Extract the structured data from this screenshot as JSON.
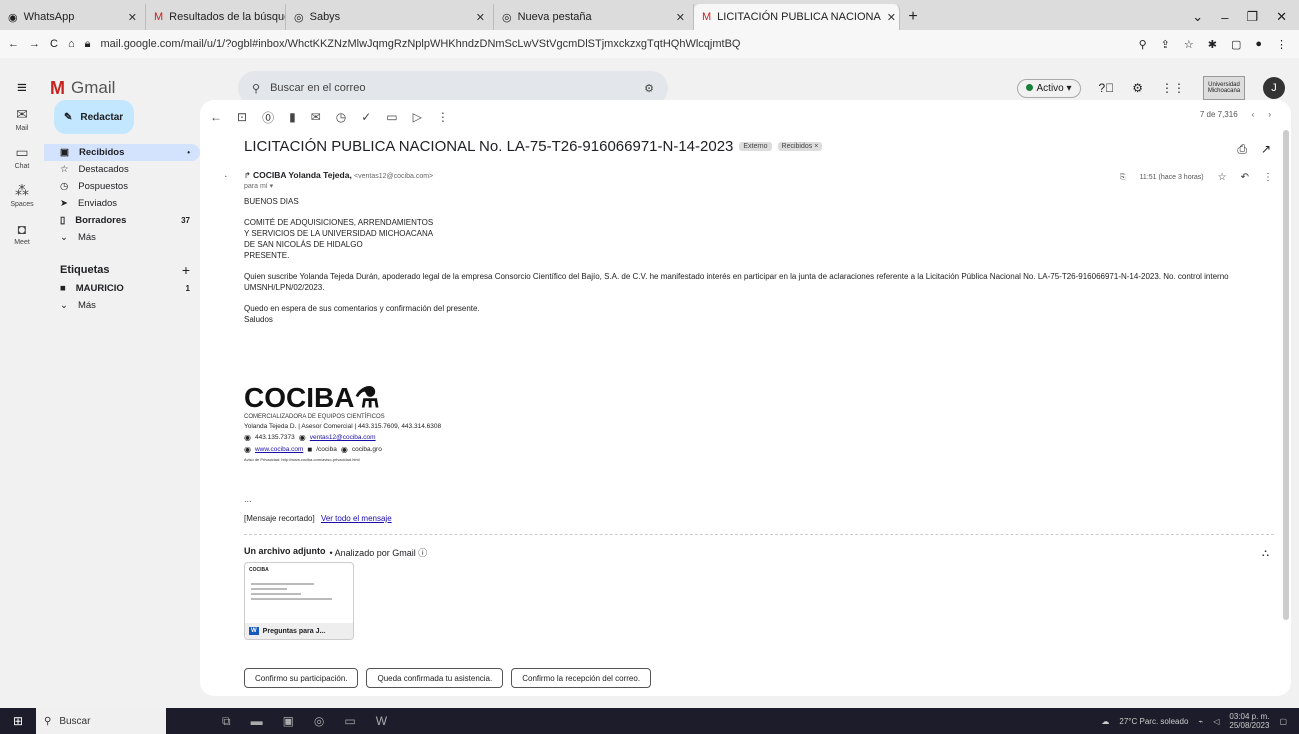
{
  "browser": {
    "tabs": [
      {
        "label": "WhatsApp",
        "icon": "whatsapp-icon"
      },
      {
        "label": "Resultados de la búsqueda - ja",
        "icon": "gmail-icon"
      },
      {
        "label": "Sabys",
        "icon": "chrome-icon"
      },
      {
        "label": "Nueva pestaña",
        "icon": "chrome-icon"
      },
      {
        "label": "LICITACIÓN PUBLICA NACIONA",
        "icon": "gmail-icon"
      }
    ],
    "url": "mail.google.com/mail/u/1/?ogbl#inbox/WhctKKZNzMlwJqmgRzNplpWHKhndzDNmScLwVStVgcmDlSTjmxckzxgTqtHQhWlcqjmtBQ"
  },
  "gmail": {
    "logo_text": "Gmail",
    "search_placeholder": "Buscar en el correo",
    "status": "Activo",
    "org_logo_text": "Universidad Michoacana",
    "avatar_initial": "J",
    "rail": [
      {
        "label": "Mail",
        "icon": "mail-icon"
      },
      {
        "label": "Chat",
        "icon": "chat-icon"
      },
      {
        "label": "Spaces",
        "icon": "spaces-icon"
      },
      {
        "label": "Meet",
        "icon": "meet-icon"
      }
    ],
    "compose_label": "Redactar",
    "nav": [
      {
        "label": "Recibidos",
        "count": "•",
        "icon": "inbox-icon"
      },
      {
        "label": "Destacados",
        "count": "",
        "icon": "star-icon"
      },
      {
        "label": "Pospuestos",
        "count": "",
        "icon": "clock-icon"
      },
      {
        "label": "Enviados",
        "count": "",
        "icon": "send-icon"
      },
      {
        "label": "Borradores",
        "count": "37",
        "icon": "draft-icon"
      },
      {
        "label": "Más",
        "count": "",
        "icon": "chevron-down-icon"
      }
    ],
    "labels_title": "Etiquetas",
    "labels": [
      {
        "label": "MAURICIO",
        "count": "1"
      },
      {
        "label": "Más",
        "count": ""
      }
    ]
  },
  "email": {
    "pager": "7 de 7,316",
    "subject": "LICITACIÓN PUBLICA NACIONAL No. LA-75-T26-916066971-N-14-2023",
    "badges": [
      "Externo",
      "Recibidos ×"
    ],
    "sender_name": "COCIBA Yolanda Tejeda,",
    "sender_email": "<ventas12@cociba.com>",
    "to": "para mí ▾",
    "time": "11:51 (hace 3 horas)",
    "body": [
      "BUENOS DIAS",
      "COMITÉ DE ADQUISICIONES, ARRENDAMIENTOS",
      "Y SERVICIOS DE LA UNIVERSIDAD MICHOACANA",
      "DE SAN NICOLÁS DE HIDALGO",
      "PRESENTE.",
      "Quien suscribe Yolanda Tejeda Durán, apoderado legal de la empresa Consorcio Científico del Bajío, S.A. de C.V. he manifestado interés en participar en la junta de aclaraciones referente a la Licitación Pública Nacional No. LA-75-T26-916066971-N-14-2023. No. control interno UMSNH/LPN/02/2023.",
      "Quedo en espera de sus comentarios y confirmación del presente.",
      "Saludos"
    ],
    "signature": {
      "brand": "COCIBA",
      "tagline": "COMERCIALIZADORA DE EQUIPOS CIENTÍFICOS",
      "contact": "Yolanda Tejeda D. | Asesor Comercial | 443.315.7609, 443.314.6308",
      "phone": "443.135.7373",
      "email": "ventas12@cociba.com",
      "web": "www.cociba.com",
      "fb": "/cociba",
      "ig": "cociba.gro",
      "privacy": "Aviso de Privacidad: http://www.cociba.com/aviso-privacidad.html"
    },
    "ellipsis": "...",
    "clipped_text": "[Mensaje recortado]",
    "clipped_link": "Ver todo el mensaje",
    "attachment_hdr_bold": "Un archivo adjunto",
    "attachment_hdr_rest": "• Analizado por Gmail ⓘ",
    "attachment_doc_brand": "COCIBA",
    "attachment_name": "Preguntas para J...",
    "smart_replies": [
      "Confirmo su participación.",
      "Queda confirmada tu asistencia.",
      "Confirmo la recepción del correo."
    ]
  },
  "taskbar": {
    "search": "Buscar",
    "tray_weather": "27°C Parc. soleado",
    "tray_time": "03:04 p. m.",
    "tray_date": "25/08/2023"
  }
}
